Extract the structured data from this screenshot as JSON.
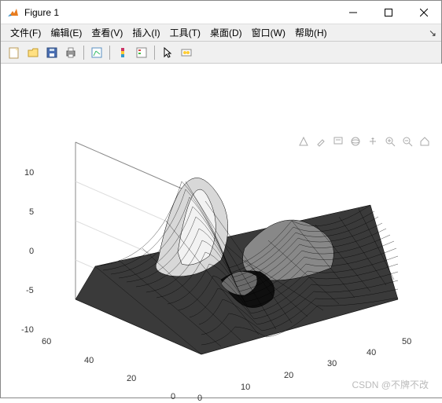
{
  "window": {
    "title": "Figure 1"
  },
  "menu": {
    "file": "文件(F)",
    "edit": "编辑(E)",
    "view": "查看(V)",
    "insert": "插入(I)",
    "tools": "工具(T)",
    "desktop": "桌面(D)",
    "window": "窗口(W)",
    "help": "帮助(H)"
  },
  "toolbar_icons": {
    "new": "new-figure",
    "open": "open",
    "save": "save",
    "print": "print",
    "edit_plot": "edit-plot",
    "insert_colorbar": "colorbar",
    "insert_legend": "legend",
    "cursor": "cursor",
    "link": "link"
  },
  "fig_tools": {
    "brush": "brush",
    "tip": "datatip",
    "rotate": "rotate3d",
    "pan": "pan",
    "zoomin": "zoom-in",
    "zoomout": "zoom-out",
    "home": "home",
    "save": "save-fig"
  },
  "watermark": "CSDN @不牌不改",
  "chart_data": {
    "type": "surface3d",
    "title": "",
    "xlabel": "",
    "ylabel": "",
    "zlabel": "",
    "x_range": [
      0,
      50
    ],
    "y_range": [
      0,
      60
    ],
    "z_range": [
      -10,
      10
    ],
    "x_ticks": [
      0,
      10,
      20,
      30,
      40,
      50
    ],
    "y_ticks": [
      0,
      20,
      40,
      60
    ],
    "z_ticks": [
      -10,
      -5,
      0,
      5,
      10
    ],
    "colormap": "gray",
    "description": "peaks-style surface with mesh lines, grayscale shading",
    "series": [
      {
        "name": "surface",
        "note": "z sampled approximately from MATLAB peaks on ~50x60 grid; central peak near z≈8 around (x≈18,y≈30), secondary hump z≈3 around (x≈35,y≈25), deep trough z≈-6 around (x≈28,y≈18), flat edges near z≈0"
      }
    ],
    "view": {
      "azimuth": -37.5,
      "elevation": 30
    }
  }
}
